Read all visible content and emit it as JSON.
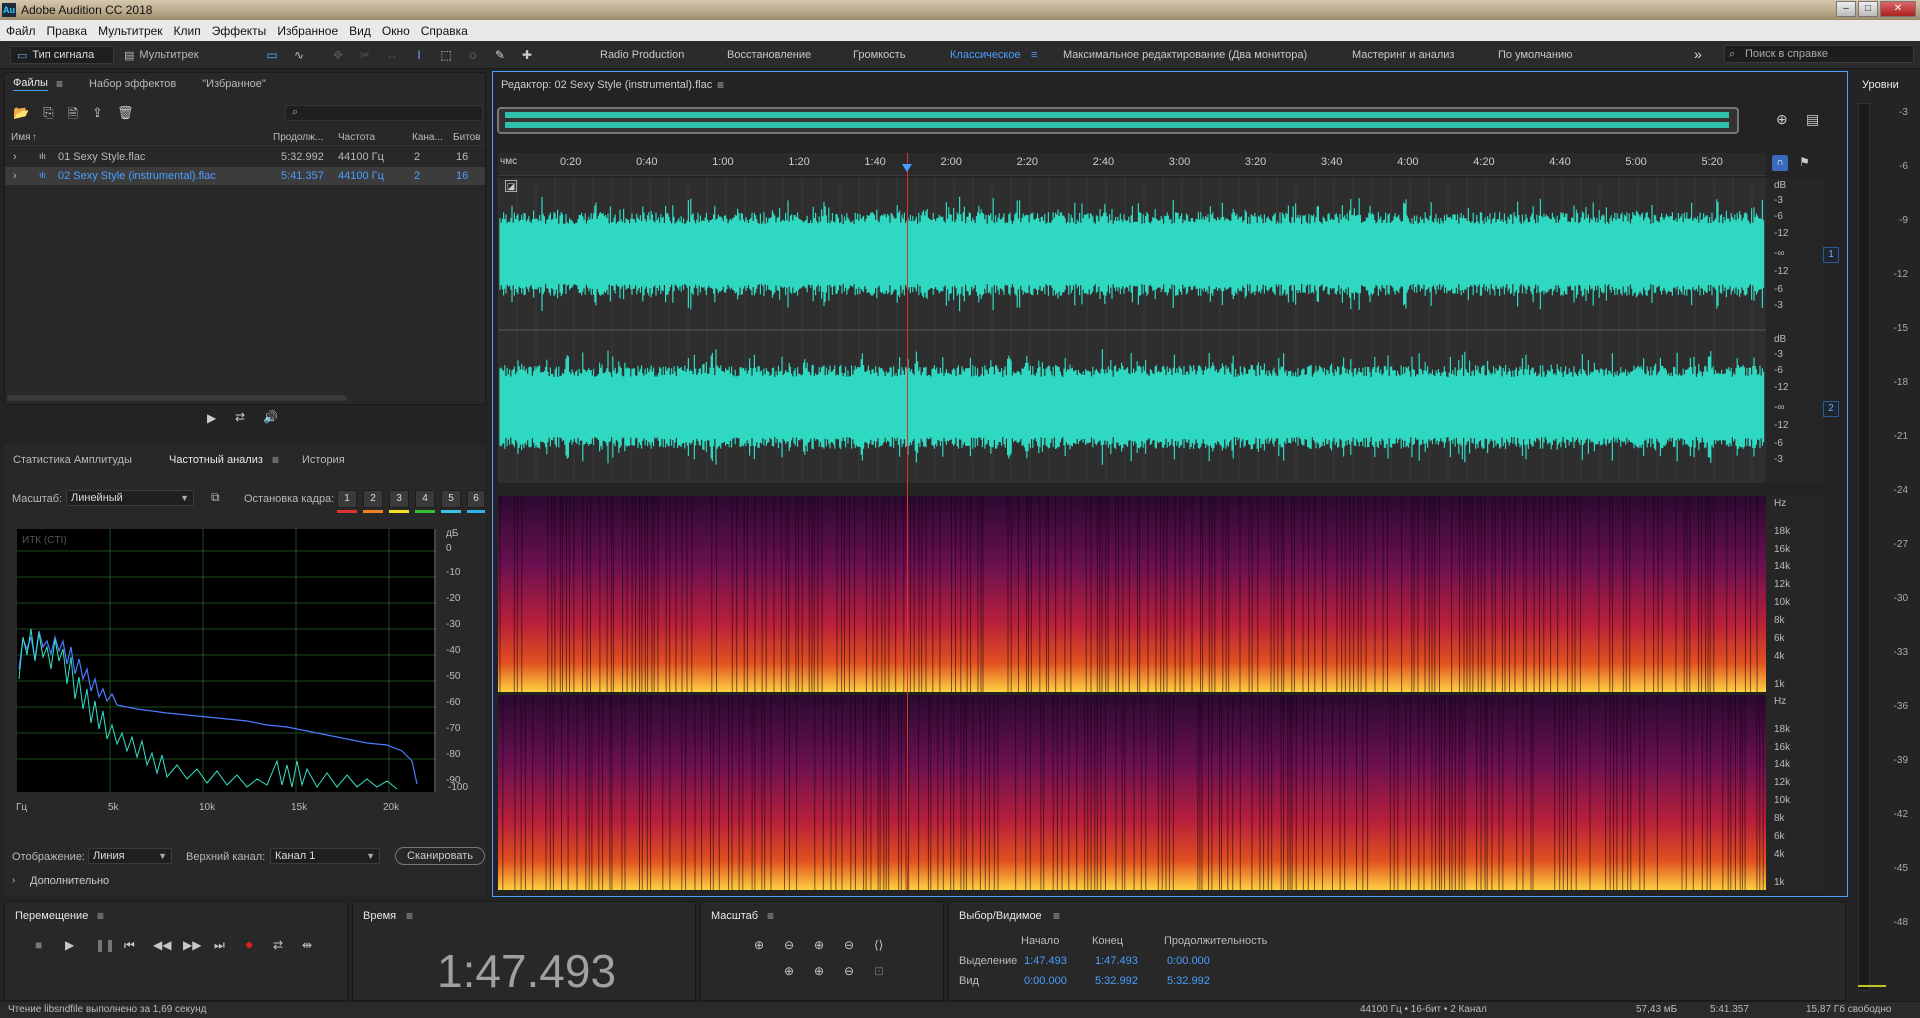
{
  "app": {
    "title": "Adobe Audition CC 2018"
  },
  "menu": [
    "Файл",
    "Правка",
    "Мультитрек",
    "Клип",
    "Эффекты",
    "Избранное",
    "Вид",
    "Окно",
    "Справка"
  ],
  "toolbar": {
    "mode_waveform": "Тип сигнала",
    "mode_multitrack": "Мультитрек",
    "workspaces": [
      "Radio Production",
      "Восстановление",
      "Громкость",
      "Классическое",
      "Максимальное редактирование (Два монитора)",
      "Мастеринг и анализ",
      "По умолчанию"
    ],
    "active_workspace": "Классическое",
    "search_placeholder": "Поиск в справке"
  },
  "files_panel": {
    "tabs": [
      "Файлы",
      "Набор эффектов",
      "\"Избранное\""
    ],
    "columns": [
      "Имя",
      "Продолж...",
      "Частота",
      "Кана...",
      "Битов"
    ],
    "rows": [
      {
        "name": "01 Sexy Style.flac",
        "duration": "5:32.992",
        "rate": "44100 Гц",
        "channels": "2",
        "bits": "16",
        "selected": false
      },
      {
        "name": "02 Sexy Style (instrumental).flac",
        "duration": "5:41.357",
        "rate": "44100 Гц",
        "channels": "2",
        "bits": "16",
        "selected": true
      }
    ]
  },
  "analysis_panel": {
    "tabs": [
      "Статистика Амплитуды",
      "Частотный анализ",
      "История"
    ],
    "scale_label": "Масштаб:",
    "scale_value": "Линейный",
    "frame_label": "Остановка кадра:",
    "frames": [
      "1",
      "2",
      "3",
      "4",
      "5",
      "6"
    ],
    "frame_colors": [
      "#e03030",
      "#f08020",
      "#f0e020",
      "#30c030",
      "#40c0e0",
      "#30b0f0"
    ],
    "graph_label": "ИТК (CTI)",
    "db_unit": "дБ",
    "db_ticks": [
      "0",
      "-10",
      "-20",
      "-30",
      "-40",
      "-50",
      "-60",
      "-70",
      "-80",
      "-90",
      "-100"
    ],
    "freq_ticks": [
      "Гц",
      "5k",
      "10k",
      "15k",
      "20k"
    ],
    "display_label": "Отображение:",
    "display_value": "Линия",
    "channel_label": "Верхний канал:",
    "channel_value": "Канал 1",
    "scan_button": "Сканировать",
    "more_label": "Дополнительно"
  },
  "editor": {
    "title": "Редактор: 02 Sexy Style (instrumental).flac",
    "ruler_unit": "чмс",
    "ruler_ticks": [
      "0:20",
      "0:40",
      "1:00",
      "1:20",
      "1:40",
      "2:00",
      "2:20",
      "2:40",
      "3:00",
      "3:20",
      "3:40",
      "4:00",
      "4:20",
      "4:40",
      "5:00",
      "5:20"
    ],
    "db_unit": "dB",
    "db_scale": [
      "-3",
      "-6",
      "-12",
      "-∞",
      "-12",
      "-6",
      "-3"
    ],
    "hz_unit": "Hz",
    "hz_scale": [
      "18k",
      "16k",
      "14k",
      "12k",
      "10k",
      "8k",
      "6k",
      "4k",
      "1k"
    ],
    "channels": [
      "1",
      "2"
    ],
    "wave_color": "#2fd8c0"
  },
  "levels": {
    "title": "Уровни",
    "ticks": [
      "-3",
      "-6",
      "-9",
      "-12",
      "-15",
      "-18",
      "-21",
      "-24",
      "-27",
      "-30",
      "-33",
      "-36",
      "-39",
      "-42",
      "-45",
      "-48"
    ]
  },
  "transport": {
    "title": "Перемещение"
  },
  "time": {
    "title": "Время",
    "value": "1:47.493"
  },
  "zoom": {
    "title": "Масштаб"
  },
  "selection": {
    "title": "Выбор/Видимое",
    "col_start": "Начало",
    "col_end": "Конец",
    "col_duration": "Продолжительность",
    "row_selection": "Выделение",
    "row_view": "Вид",
    "sel_start": "1:47.493",
    "sel_end": "1:47.493",
    "sel_duration": "0:00.000",
    "view_start": "0:00.000",
    "view_end": "5:32.992",
    "view_duration": "5:32.992"
  },
  "status": {
    "message": "Чтение libsndfile выполнено за 1,69 секунд",
    "format": "44100 Гц • 16-бит • 2 Канал",
    "size": "57,43 мБ",
    "duration": "5:41.357",
    "free": "15,87 Гб свободно"
  }
}
